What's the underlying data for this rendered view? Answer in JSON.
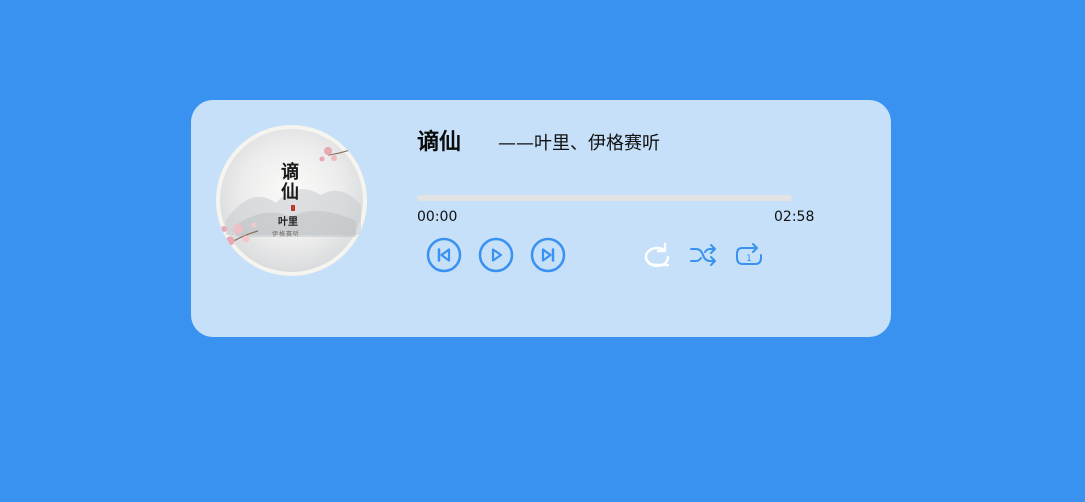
{
  "song": {
    "title": "谪仙",
    "artist": "——叶里、伊格赛听"
  },
  "album_art": {
    "title_line1": "谪",
    "title_line2": "仙",
    "artist": "叶里",
    "credit": "伊格赛听"
  },
  "playback": {
    "current_time": "00:00",
    "total_time": "02:58",
    "progress": 0
  },
  "controls": {
    "previous_icon": "skip-previous-icon",
    "play_icon": "play-icon",
    "next_icon": "skip-next-icon",
    "repeat_icon": "repeat-icon",
    "shuffle_icon": "shuffle-icon",
    "repeat_one_icon": "repeat-one-icon",
    "repeat_one_badge": "1"
  },
  "colors": {
    "background": "#3992ef",
    "card": "#c5e0f8",
    "accent": "#3992ef",
    "track": "#e3e3e3",
    "active_mode": "#ffffff"
  }
}
